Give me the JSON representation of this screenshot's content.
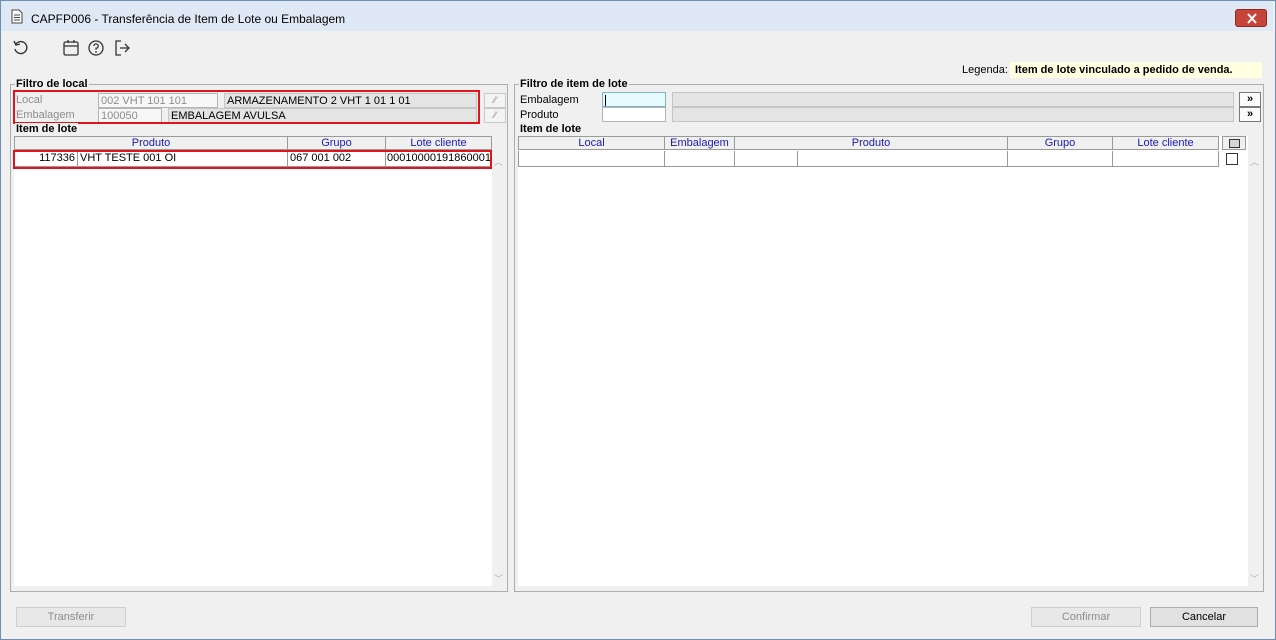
{
  "window": {
    "title": "CAPFP006 - Transferência de Item de Lote ou Embalagem"
  },
  "toolbar": {
    "icons": [
      "refresh-icon",
      "calendar-icon",
      "help-icon",
      "exit-icon"
    ]
  },
  "legend": {
    "label": "Legenda:",
    "text": "Item de lote vinculado a pedido de venda.",
    "color": "#ffffe1"
  },
  "left": {
    "filter_title": "Filtro de local",
    "local_label": "Local",
    "local_code": "002 VHT 101 101",
    "local_desc": "ARMAZENAMENTO 2 VHT 1 01 1 01",
    "embalagem_label": "Embalagem",
    "embalagem_code": "100050",
    "embalagem_desc": "EMBALAGEM AVULSA",
    "grid_title": "Item de lote",
    "columns": [
      "Produto",
      "Grupo",
      "Lote cliente"
    ],
    "rows": [
      {
        "code": "117336",
        "produto": "VHT TESTE 001 OI",
        "grupo": "067 001 002",
        "lote": "00010000191860001"
      }
    ]
  },
  "right": {
    "filter_title": "Filtro de item de lote",
    "embalagem_label": "Embalagem",
    "produto_label": "Produto",
    "lookup_label": "»",
    "grid_title": "Item de lote",
    "columns": [
      "Local",
      "Embalagem",
      "Produto",
      "Grupo",
      "Lote cliente"
    ]
  },
  "buttons": {
    "transferir": "Transferir",
    "confirmar": "Confirmar",
    "cancelar": "Cancelar"
  },
  "colors": {
    "highlight_border": "#e0151b",
    "header_text": "#1a1ab4",
    "close_button": "#c7443a"
  }
}
